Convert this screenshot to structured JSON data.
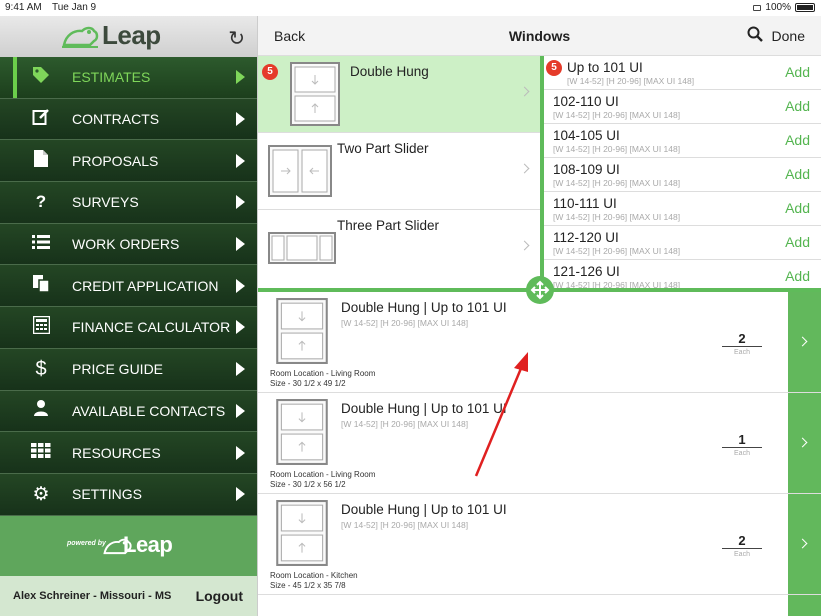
{
  "status_bar": {
    "time": "9:41 AM",
    "date": "Tue Jan 9",
    "battery": "100%"
  },
  "sidebar": {
    "logo_text": "Leap",
    "items": [
      {
        "label": "ESTIMATES",
        "icon": "tag-icon",
        "active": true
      },
      {
        "label": "CONTRACTS",
        "icon": "edit-icon"
      },
      {
        "label": "PROPOSALS",
        "icon": "document-icon"
      },
      {
        "label": "SURVEYS",
        "icon": "question-icon"
      },
      {
        "label": "WORK ORDERS",
        "icon": "list-icon"
      },
      {
        "label": "CREDIT APPLICATION",
        "icon": "copy-icon"
      },
      {
        "label": "FINANCE CALCULATOR",
        "icon": "calculator-icon"
      },
      {
        "label": "PRICE GUIDE",
        "icon": "dollar-icon"
      },
      {
        "label": "AVAILABLE CONTACTS",
        "icon": "person-icon"
      },
      {
        "label": "RESOURCES",
        "icon": "grid-icon"
      },
      {
        "label": "SETTINGS",
        "icon": "gear-icon"
      }
    ],
    "powered_by": "powered by",
    "powered_logo": "Leap",
    "user": "Alex Schreiner - Missouri - MS",
    "logout": "Logout"
  },
  "navbar": {
    "back": "Back",
    "title": "Windows",
    "done": "Done"
  },
  "window_types": [
    {
      "name": "Double Hung",
      "badge": "5",
      "selected": true
    },
    {
      "name": "Two Part Slider"
    },
    {
      "name": "Three Part Slider"
    }
  ],
  "sizes_badge": "5",
  "add_label": "Add",
  "sizes": [
    {
      "name": "Up to 101 UI",
      "dims": "[W 14-52] [H 20-96] [MAX UI 148]"
    },
    {
      "name": "102-110 UI",
      "dims": "[W 14-52] [H 20-96] [MAX UI 148]"
    },
    {
      "name": "104-105 UI",
      "dims": "[W 14-52] [H 20-96] [MAX UI 148]"
    },
    {
      "name": "108-109 UI",
      "dims": "[W 14-52] [H 20-96] [MAX UI 148]"
    },
    {
      "name": "110-111 UI",
      "dims": "[W 14-52] [H 20-96] [MAX UI 148]"
    },
    {
      "name": "112-120 UI",
      "dims": "[W 14-52] [H 20-96] [MAX UI 148]"
    },
    {
      "name": "121-126 UI",
      "dims": "[W 14-52] [H 20-96] [MAX UI 148]"
    }
  ],
  "line_items": [
    {
      "title": "Double Hung | Up to 101 UI",
      "dims": "[W 14-52] [H 20-96] [MAX UI 148]",
      "location": "Room Location - Living Room",
      "size": "Size - 30 1/2 x 49 1/2",
      "qty": "2",
      "unit": "Each"
    },
    {
      "title": "Double Hung | Up to 101 UI",
      "dims": "[W 14-52] [H 20-96] [MAX UI 148]",
      "location": "Room Location - Living Room",
      "size": "Size - 30 1/2 x 56 1/2",
      "qty": "1",
      "unit": "Each"
    },
    {
      "title": "Double Hung | Up to 101 UI",
      "dims": "[W 14-52] [H 20-96] [MAX UI 148]",
      "location": "Room Location - Kitchen",
      "size": "Size - 45 1/2 x 35 7/8",
      "qty": "2",
      "unit": "Each"
    }
  ],
  "colors": {
    "accent_green": "#5fbb5a",
    "active_green": "#7fd65a",
    "sidebar_dark": "#1e3b1e",
    "badge_red": "#e53b2a",
    "annotation_red": "#e02020"
  }
}
